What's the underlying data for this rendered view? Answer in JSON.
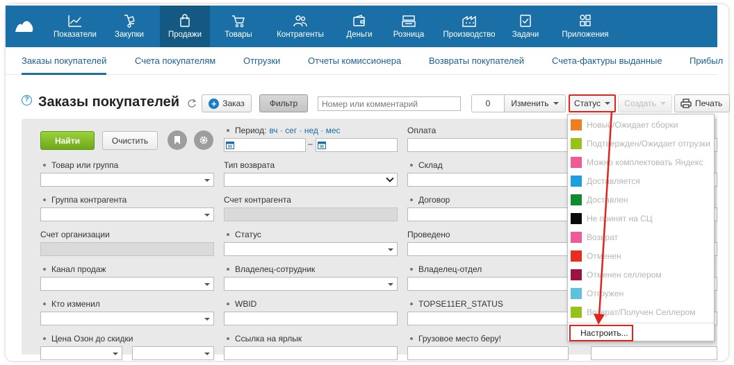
{
  "nav": {
    "items": [
      {
        "label": "Показатели",
        "icon": "chart-line-icon"
      },
      {
        "label": "Закупки",
        "icon": "hand-truck-icon"
      },
      {
        "label": "Продажи",
        "icon": "shopping-bag-icon",
        "active": true
      },
      {
        "label": "Товары",
        "icon": "shopping-cart-icon"
      },
      {
        "label": "Контрагенты",
        "icon": "users-icon"
      },
      {
        "label": "Деньги",
        "icon": "wallet-icon"
      },
      {
        "label": "Розница",
        "icon": "cash-register-icon"
      },
      {
        "label": "Производство",
        "icon": "factory-icon"
      },
      {
        "label": "Задачи",
        "icon": "task-check-icon"
      },
      {
        "label": "Приложения",
        "icon": "apps-grid-icon"
      }
    ]
  },
  "subnav": {
    "items": [
      {
        "label": "Заказы покупателей",
        "active": true
      },
      {
        "label": "Счета покупателям"
      },
      {
        "label": "Отгрузки"
      },
      {
        "label": "Отчеты комиссионера"
      },
      {
        "label": "Возвраты покупателей"
      },
      {
        "label": "Счета-фактуры выданные"
      },
      {
        "label": "Прибыл"
      }
    ]
  },
  "toolbar": {
    "help": "?",
    "title": "Заказы покупателей",
    "order_label": "Заказ",
    "filter_label": "Фильтр",
    "search_placeholder": "Номер или комментарий",
    "count": "0",
    "edit_label": "Изменить",
    "status_label": "Статус",
    "create_label": "Создать",
    "print_label": "Печать"
  },
  "filter": {
    "find_label": "Найти",
    "clear_label": "Очистить",
    "period_label": "Период:",
    "period_links": "вч · сег · нед · мес",
    "date_sep": "–",
    "fields": {
      "payment": "Оплата",
      "product": "Товар или группа",
      "return_type": "Тип возврата",
      "warehouse": "Склад",
      "contractor_group": "Группа контрагента",
      "contractor_account": "Счет контрагента",
      "contract": "Договор",
      "org_account": "Счет организации",
      "status": "Статус",
      "posted": "Проведено",
      "sales_channel": "Канал продаж",
      "owner_employee": "Владелец-сотрудник",
      "owner_department": "Владелец-отдел",
      "changed_by": "Кто изменил",
      "wbid": "WBID",
      "topseller_status": "TOPSE11ER_STATUS",
      "ozon_price": "Цена Озон до скидки",
      "label_link": "Ссылка на ярлык",
      "cargo_place": "Грузовое место беру!"
    }
  },
  "status_menu": {
    "items": [
      {
        "label": "Новый/Ожидает сборки",
        "color": "#f07d1e"
      },
      {
        "label": "Подтвержден/Ожидает отгрузки",
        "color": "#96c21a"
      },
      {
        "label": "Можно комплектовать Яндекс",
        "color": "#ef5b98"
      },
      {
        "label": "Доставляется",
        "color": "#1a9fe0"
      },
      {
        "label": "Доставлен",
        "color": "#108a30"
      },
      {
        "label": "Не принят на СЦ",
        "color": "#0a0a0a"
      },
      {
        "label": "Возврат",
        "color": "#ef5b98"
      },
      {
        "label": "Отменен",
        "color": "#ee2a1c"
      },
      {
        "label": "Отменен селлером",
        "color": "#9c1240"
      },
      {
        "label": "Отгружен",
        "color": "#5bc2e0"
      },
      {
        "label": "Возврат/Получен Селлером",
        "color": "#96c21a"
      }
    ],
    "configure_label": "Настроить..."
  },
  "colors": {
    "nav_bg": "#1a6fa6",
    "nav_active": "#135984",
    "highlight": "#e2231a"
  }
}
